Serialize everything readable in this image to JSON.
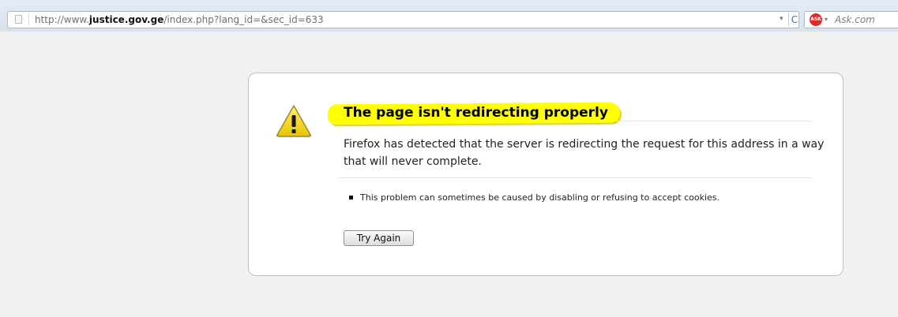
{
  "browser": {
    "url": {
      "prefix": "http://www.",
      "domain": "justice.gov.ge",
      "path": "/index.php?lang_id=&sec_id=633"
    },
    "url_dropdown_glyph": "▾",
    "reload_glyph": "C",
    "search": {
      "engine_logo_text": "ASK",
      "engine_arrow_glyph": "▾",
      "placeholder": "Ask.com"
    },
    "icons": {
      "site_identity": "page-icon",
      "reload": "reload-icon",
      "search_engine": "ask-logo-icon"
    }
  },
  "error": {
    "title": "The page isn't redirecting properly",
    "description": "Firefox has detected that the server is redirecting the request for this address in a way that will never complete.",
    "hints": [
      "This problem can sometimes be caused by disabling or refusing to accept cookies."
    ],
    "button_label": "Try Again",
    "icon": "warning-icon"
  },
  "colors": {
    "title_highlight": "#ffff00",
    "warning_fill": "#f5d70b",
    "page_background": "#f1f1f1"
  }
}
